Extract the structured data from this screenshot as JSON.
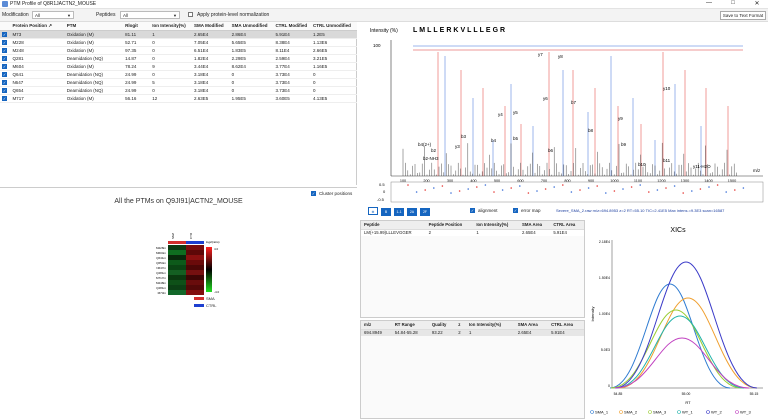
{
  "window": {
    "title": "PTM Profile of Q8R1JACTN2_MOUSE"
  },
  "toolbar": {
    "modification_label": "Modification",
    "modification_value": "All",
    "peptides_label": "Peptides",
    "peptides_value": "All",
    "normalization_label": "Apply protein-level normalization",
    "save_label": "Save to Text Format"
  },
  "ptm_table": {
    "headers": [
      "",
      "Protein Position",
      "PTM",
      "Rlogit",
      "Ion Intensity(%)",
      "SMA Modified",
      "SMA Unmodified",
      "CTRL Modified",
      "CTRL Unmodified"
    ],
    "rows": [
      [
        "M73",
        "Oxidation (M)",
        "81.11",
        "1",
        "2.65E4",
        "2.86E4",
        "5.91E4",
        "1.2E5"
      ],
      [
        "M228",
        "Oxidation (M)",
        "52.71",
        "0",
        "7.05E4",
        "5.65E5",
        "8.38E4",
        "1.13E6"
      ],
      [
        "M248",
        "Oxidation (M)",
        "97.35",
        "0",
        "6.51E4",
        "1.83E5",
        "8.11E4",
        "2.66E5"
      ],
      [
        "Q281",
        "Deamidation (NQ)",
        "14.87",
        "0",
        "1.82E4",
        "2.29E5",
        "2.59E4",
        "3.21E5"
      ],
      [
        "M604",
        "Oxidation (M)",
        "78.24",
        "9",
        "3.44E4",
        "8.62E4",
        "3.77E4",
        "1.16E5"
      ],
      [
        "Q641",
        "Deamidation (NQ)",
        "24.99",
        "0",
        "3.18E4",
        "0",
        "3.73E4",
        "0"
      ],
      [
        "N647",
        "Deamidation (NQ)",
        "24.99",
        "5",
        "3.18E4",
        "0",
        "3.73E4",
        "0"
      ],
      [
        "Q654",
        "Deamidation (NQ)",
        "24.99",
        "0",
        "3.18E4",
        "0",
        "3.73E4",
        "0"
      ],
      [
        "M717",
        "Oxidation (M)",
        "56.16",
        "12",
        "2.63E5",
        "1.95E5",
        "3.60E5",
        "4.13E5"
      ]
    ]
  },
  "heatmap": {
    "title": "All the PTMs on Q9JI91|ACTN2_MOUSE",
    "cluster_label": "Cluster positions",
    "scale_title": "log2(ratio)",
    "scale_max": "4.0",
    "scale_min": "-4.0",
    "col_labels": [
      "SMA",
      "CTRL"
    ],
    "row_labels": [
      "M228m",
      "M604m",
      "Q641m",
      "Q654m",
      "N647m",
      "Q281m",
      "M717m",
      "M248m",
      "Q281m",
      "M73m"
    ],
    "legend": [
      {
        "name": "SMA",
        "color": "#d32f2f"
      },
      {
        "name": "CTRL",
        "color": "#1e3fd0"
      }
    ]
  },
  "spectrum": {
    "ylabel": "Intensity (%)",
    "xlabel": "m/z",
    "sequence": "LMLLERKVLLLEGR",
    "y_top": "100",
    "x_ticks": [
      "100",
      "200",
      "300",
      "400",
      "500",
      "600",
      "700",
      "800",
      "900",
      "1000",
      "1100",
      "1200",
      "1300",
      "1400",
      "1500"
    ],
    "annotations": [
      "y7",
      "y8",
      "y10",
      "y4",
      "y5",
      "y6",
      "b7",
      "b3",
      "y3",
      "b4",
      "b5",
      "b6",
      "b8",
      "y9",
      "b9",
      "b2",
      "b2-NH3",
      "b4(2+)",
      "b10",
      "b11",
      "y11-H2O"
    ],
    "err_ticks": [
      "0.5",
      "0",
      "-0.5"
    ],
    "alignment_label": "alignment",
    "error_map_label": "error map",
    "info_text": "Severe_SMA_2.raw m/z=694.8953 z=2 RT=55.10 TIC=2.41E5 Max intens.=9.3E3 scan=16587",
    "buttons": [
      "⊕",
      "B",
      "1-1",
      "2A",
      "2F"
    ]
  },
  "peptide_table": {
    "headers": [
      "Peptide",
      "Peptide Position",
      "Ion Intensity(%)",
      "SMA Area",
      "CTRL Area"
    ],
    "rows": [
      [
        "LM(+15.99)LLLEVGGER",
        "2",
        "1",
        "2.65E4",
        "5.91E4"
      ]
    ]
  },
  "psm_table": {
    "headers": [
      "m/z",
      "RT Range",
      "Quality",
      "z",
      "Ion Intensity(%)",
      "SMA Area",
      "CTRL Area"
    ],
    "rows": [
      [
        "694.8949",
        "54.84-55.28",
        "93.22",
        "2",
        "1",
        "2.65E4",
        "5.91E4"
      ]
    ]
  },
  "xic": {
    "title": "XICs",
    "ylabel": "Intensity",
    "xlabel": "RT",
    "y_ticks": [
      "2.18E4",
      "1.50E4",
      "1.00E4",
      "5.0E3",
      "0"
    ],
    "x_ticks": [
      "54.85",
      "55.00",
      "55.15"
    ],
    "legend": [
      {
        "name": "SMA_1",
        "color": "#2e7bd1"
      },
      {
        "name": "SMA_2",
        "color": "#f0a030"
      },
      {
        "name": "SMA_3",
        "color": "#9acd32"
      },
      {
        "name": "WT_1",
        "color": "#20b2aa"
      },
      {
        "name": "WT_2",
        "color": "#3a3ac8"
      },
      {
        "name": "WT_3",
        "color": "#c040c0"
      }
    ]
  }
}
